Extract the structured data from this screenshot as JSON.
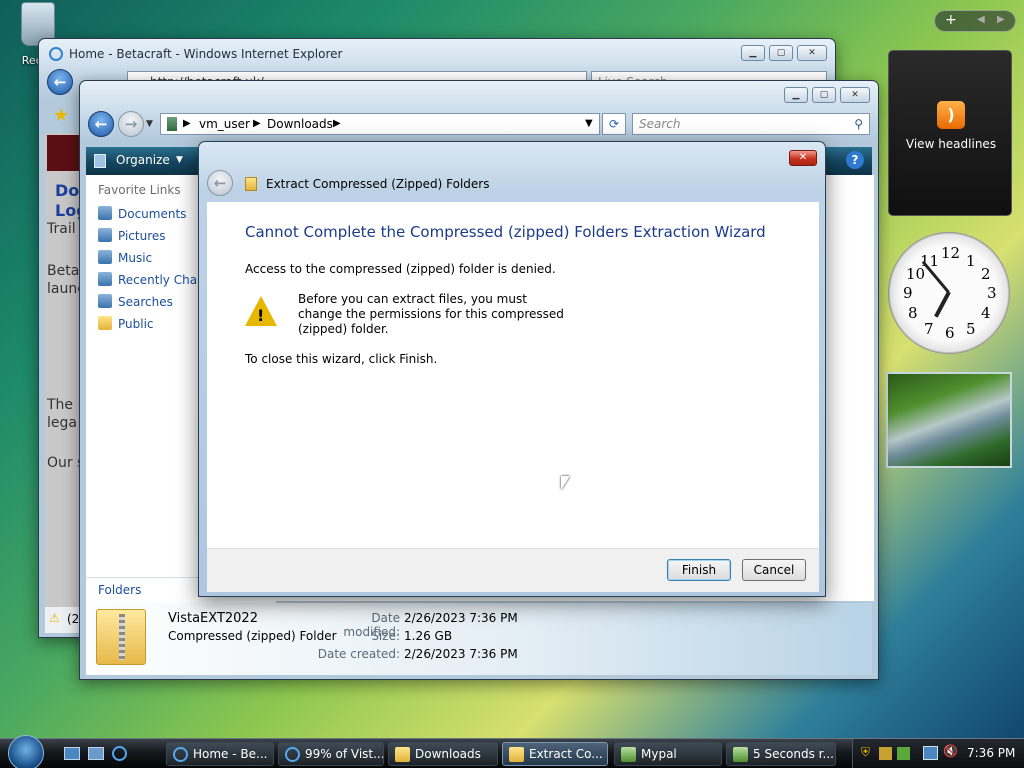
{
  "desktop": {
    "recycle_label": "Recyc"
  },
  "ie": {
    "title": "Home - Betacraft - Windows Internet Explorer",
    "url": "http://betacraft.uk/",
    "search_placeholder": "Live Search",
    "page_fragments": [
      "Dow",
      "Log",
      "Trail",
      "Beta",
      "launc",
      "The",
      "lega",
      "Our s"
    ],
    "status": "(2"
  },
  "explorer": {
    "path": [
      "vm_user",
      "Downloads"
    ],
    "search_placeholder": "Search",
    "toolbar": {
      "organize": "Organize"
    },
    "favorite_links_heading": "Favorite Links",
    "links": [
      "Documents",
      "Pictures",
      "Music",
      "Recently Changed",
      "Searches",
      "Public"
    ],
    "folders_label": "Folders",
    "details": {
      "name": "VistaEXT2022",
      "type": "Compressed (zipped) Folder",
      "date_modified_label": "Date modified:",
      "date_modified": "2/26/2023 7:36 PM",
      "size_label": "Size:",
      "size": "1.26 GB",
      "date_created_label": "Date created:",
      "date_created": "2/26/2023 7:36 PM"
    }
  },
  "wizard": {
    "title": "Extract Compressed (Zipped) Folders",
    "heading": "Cannot Complete the Compressed (zipped) Folders Extraction Wizard",
    "message1": "Access to the compressed (zipped) folder is denied.",
    "warning_lines": [
      "Before you can extract files, you must",
      "change the permissions for this compressed",
      "(zipped) folder."
    ],
    "message2": "To close this wizard, click Finish.",
    "finish": "Finish",
    "cancel": "Cancel"
  },
  "gadgets": {
    "feed_label": "View headlines",
    "clock_numbers": [
      "12",
      "1",
      "2",
      "3",
      "4",
      "5",
      "6",
      "7",
      "8",
      "9",
      "10",
      "11"
    ]
  },
  "taskbar": {
    "items": [
      "Home - Be...",
      "99% of Vist...",
      "Downloads",
      "Extract Co...",
      "Mypal",
      "5 Seconds r..."
    ],
    "time": "7:36 PM"
  }
}
